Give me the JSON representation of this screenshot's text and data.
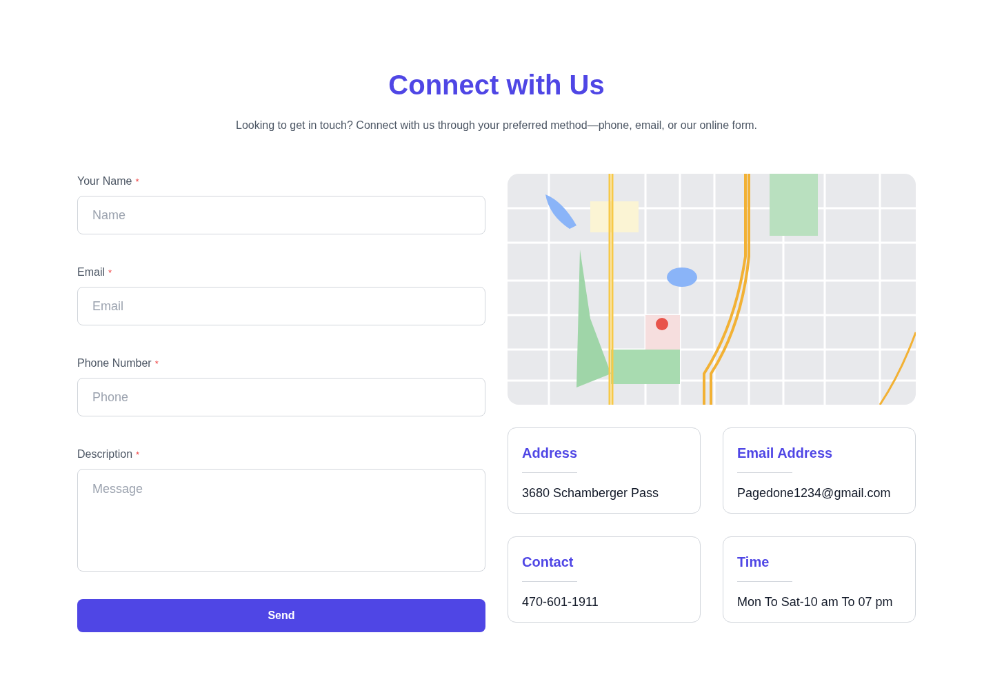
{
  "title": "Connect with Us",
  "subtitle": "Looking to get in touch? Connect with us through your preferred method—phone, email, or our online form.",
  "form": {
    "fields": [
      {
        "kind": "input",
        "label": "Your Name",
        "required_mark": "*",
        "placeholder": "Name"
      },
      {
        "kind": "input",
        "label": "Email",
        "required_mark": "*",
        "placeholder": "Email"
      },
      {
        "kind": "input",
        "label": "Phone Number",
        "required_mark": "*",
        "placeholder": "Phone"
      },
      {
        "kind": "textarea",
        "label": "Description",
        "required_mark": "*",
        "placeholder": "Message"
      }
    ],
    "submit_button": "Send"
  },
  "info_cards": [
    {
      "title": "Address",
      "value": "3680 Schamberger Pass"
    },
    {
      "title": "Email Address",
      "value": "Pagedone1234@gmail.com"
    },
    {
      "title": "Contact",
      "value": "470-601-1911"
    },
    {
      "title": "Time",
      "value": "Mon To Sat-10 am To 07 pm"
    }
  ]
}
